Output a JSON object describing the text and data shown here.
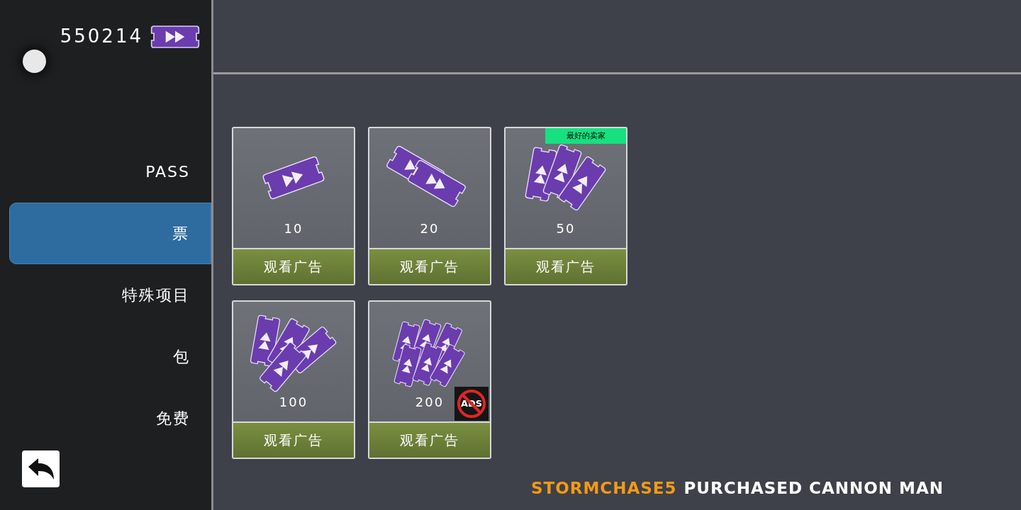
{
  "currency": {
    "amount": "550214"
  },
  "sidebar": {
    "items": [
      {
        "label": "PASS",
        "selected": false
      },
      {
        "label": "票",
        "selected": true
      },
      {
        "label": "特殊项目",
        "selected": false
      },
      {
        "label": "包",
        "selected": false
      },
      {
        "label": "免费",
        "selected": false
      }
    ]
  },
  "offers": [
    {
      "amount": "10",
      "button": "观看广告"
    },
    {
      "amount": "20",
      "button": "观看广告"
    },
    {
      "amount": "50",
      "button": "观看广告",
      "badge": "最好的卖家"
    },
    {
      "amount": "100",
      "button": "观看广告"
    },
    {
      "amount": "200",
      "button": "观看广告",
      "no_ads": "ADS"
    }
  ],
  "notification": {
    "player": "STORMCHASE5",
    "message": "PURCHASED CANNON MAN"
  }
}
